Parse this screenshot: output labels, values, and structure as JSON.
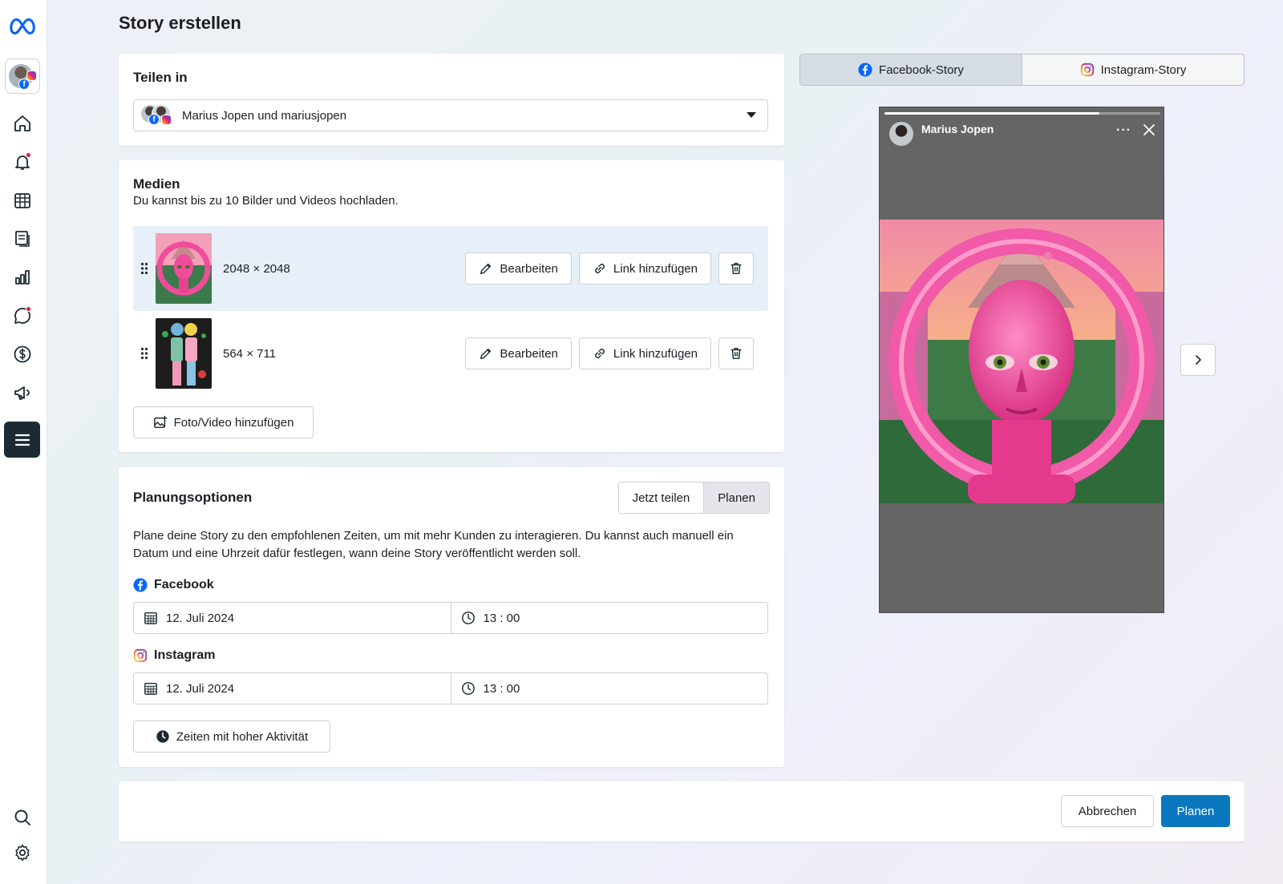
{
  "app": {
    "brand_icon": "meta-logo-icon"
  },
  "page": {
    "title": "Story erstellen"
  },
  "share": {
    "title": "Teilen in",
    "selected_accounts": "Marius Jopen und mariusjopen"
  },
  "media": {
    "title": "Medien",
    "subtitle": "Du kannst bis zu 10 Bilder und Videos hochladen.",
    "items": [
      {
        "dims": "2048 × 2048",
        "edit_label": "Bearbeiten",
        "link_label": "Link hinzufügen"
      },
      {
        "dims": "564 × 711",
        "edit_label": "Bearbeiten",
        "link_label": "Link hinzufügen"
      }
    ],
    "add_label": "Foto/Video hinzufügen"
  },
  "planning": {
    "title": "Planungsoptionen",
    "share_now_label": "Jetzt teilen",
    "schedule_label": "Planen",
    "selected_mode": "Planen",
    "description": "Plane deine Story zu den empfohlenen Zeiten, um mit mehr Kunden zu interagieren. Du kannst auch manuell ein Datum und eine Uhrzeit dafür festlegen, wann deine Story veröffentlicht werden soll.",
    "facebook": {
      "label": "Facebook",
      "date": "12. Juli 2024",
      "time": "13 : 00"
    },
    "instagram": {
      "label": "Instagram",
      "date": "12. Juli 2024",
      "time": "13 : 00"
    },
    "peak_times_label": "Zeiten mit hoher Aktivität"
  },
  "footer": {
    "cancel_label": "Abbrechen",
    "submit_label": "Planen"
  },
  "preview": {
    "tabs": [
      "Facebook-Story",
      "Instagram-Story"
    ],
    "active_tab": "Facebook-Story",
    "story_user": "Marius Jopen",
    "more_label": "···",
    "progress": 0.78
  },
  "colors": {
    "primary": "#0a78be",
    "facebook": "#0866ff",
    "sidebar_active": "#1c2b33",
    "notification": "#e41e3f"
  }
}
